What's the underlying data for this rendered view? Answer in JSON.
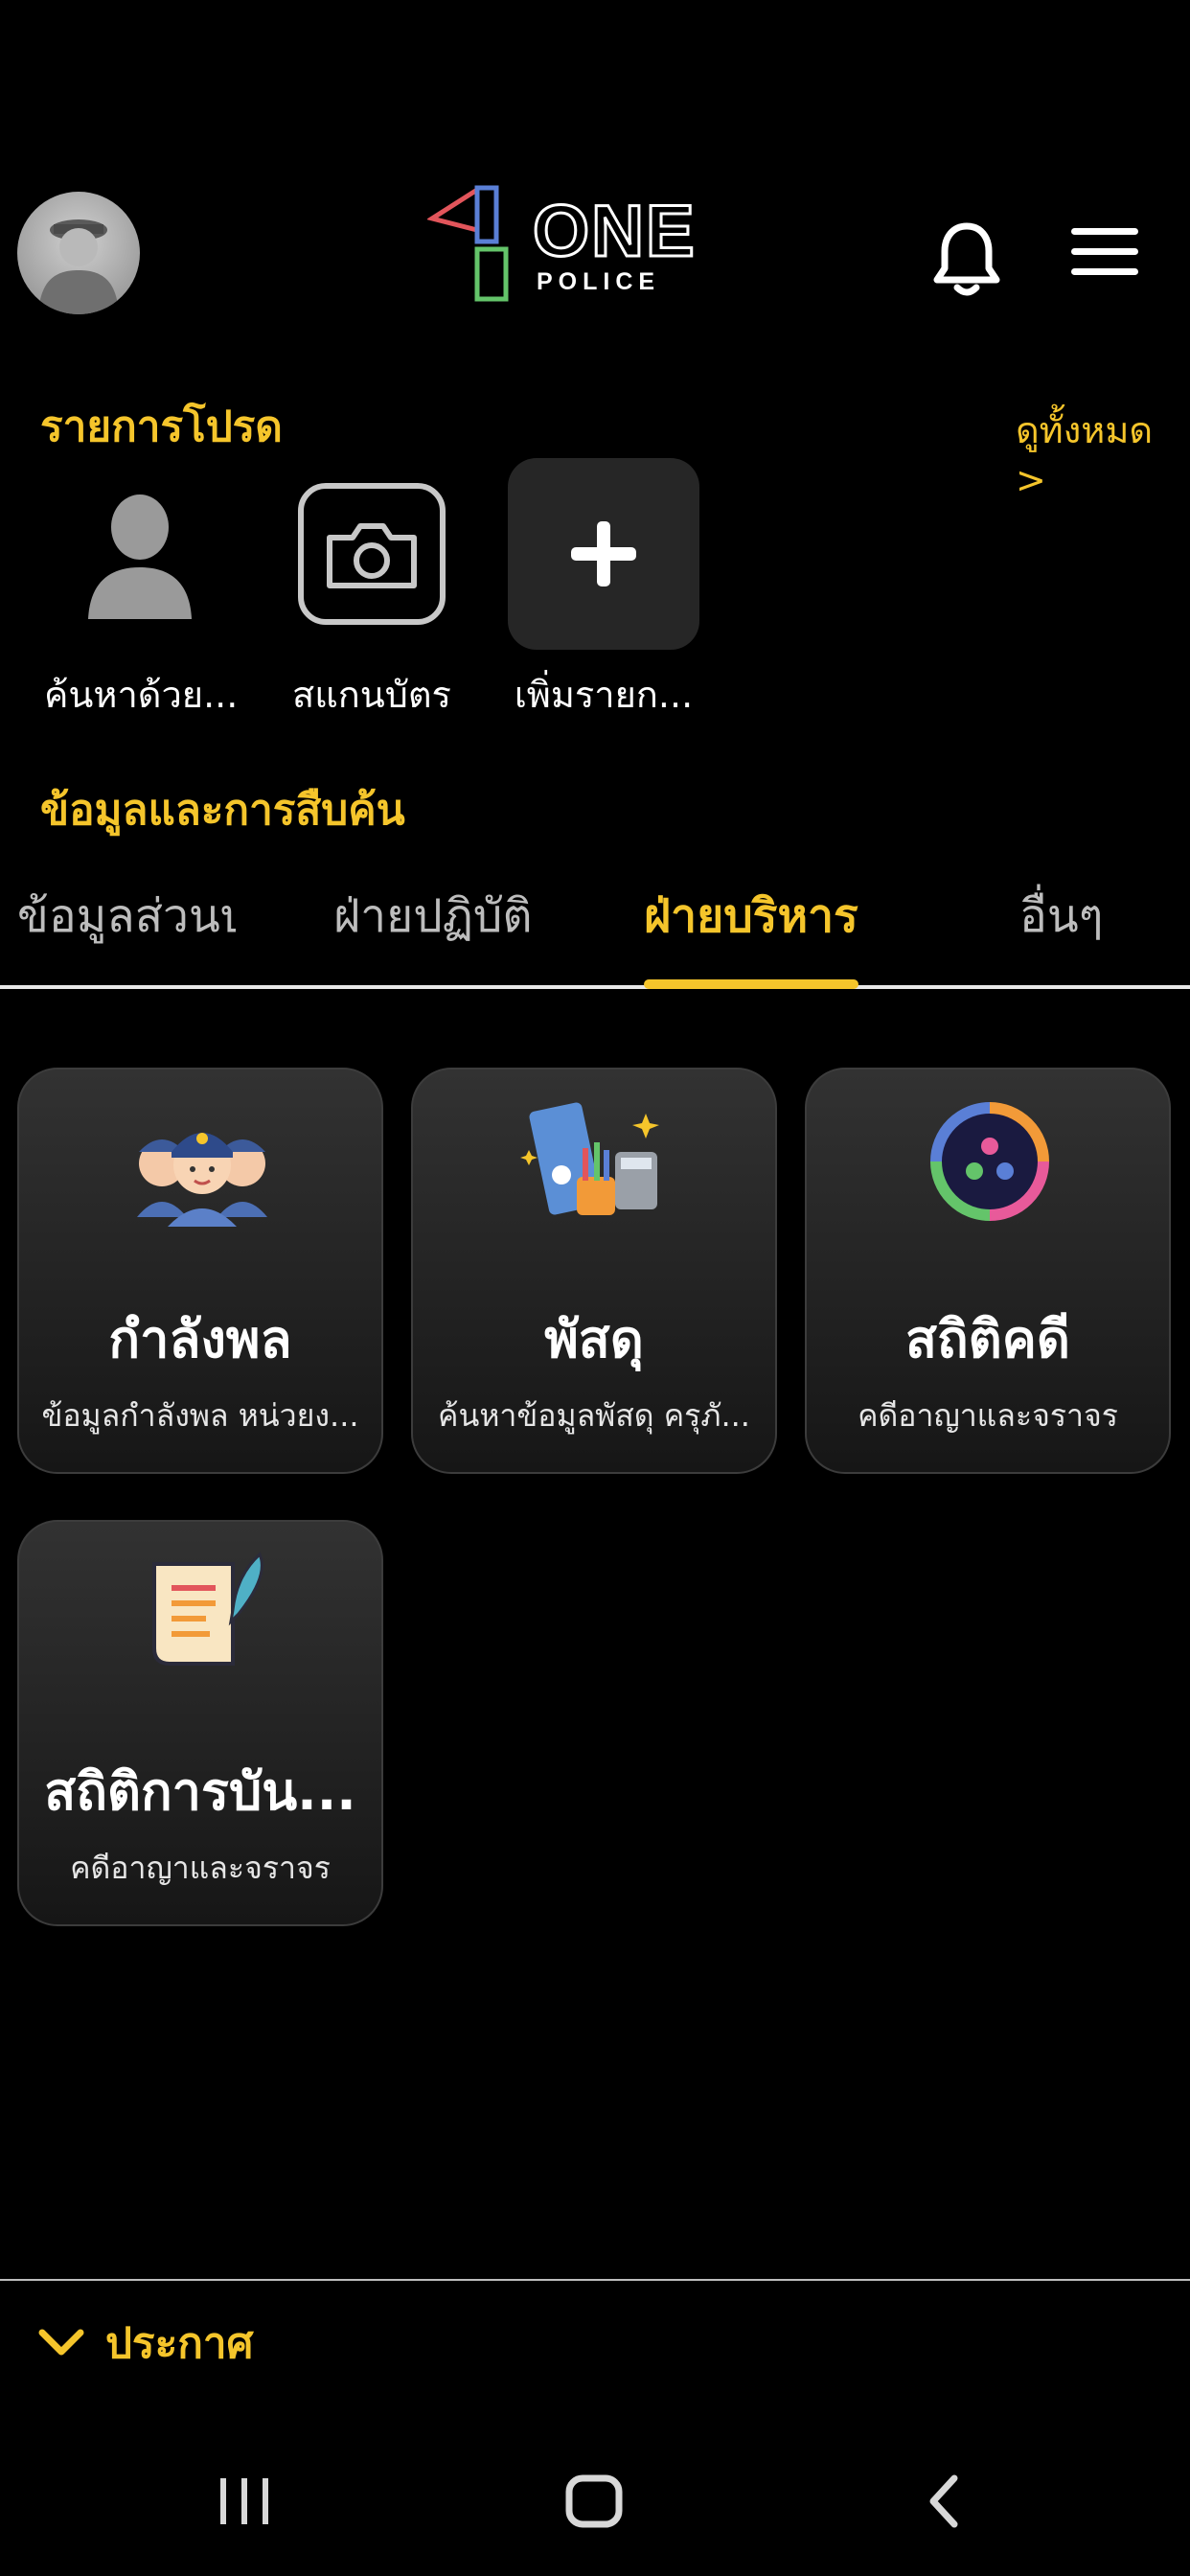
{
  "header": {
    "logo_main": "ONE",
    "logo_sub": "POLICE",
    "icons": [
      "officer-avatar",
      "bell-icon",
      "hamburger-menu-icon"
    ]
  },
  "favorites": {
    "title": "รายการโปรด",
    "see_all": "ดูทั้งหมด >",
    "items": [
      {
        "label": "ค้นหาด้วย...",
        "icon": "person-icon"
      },
      {
        "label": "สแกนบัตร",
        "icon": "camera-icon"
      },
      {
        "label": "เพิ่มรายก...",
        "icon": "plus-icon"
      }
    ]
  },
  "investigation": {
    "title": "ข้อมูลและการสืบค้น",
    "tabs": [
      {
        "label": "ข้อมูลส่วนบ",
        "active": false
      },
      {
        "label": "ฝ่ายปฏิบัติ",
        "active": false
      },
      {
        "label": "ฝ่ายบริหาร",
        "active": true
      },
      {
        "label": "อื่นๆ",
        "active": false
      }
    ]
  },
  "cards": [
    {
      "title": "กำลังพล",
      "subtitle": "ข้อมูลกำลังพล หน่วยง...",
      "icon": "police-officers-icon"
    },
    {
      "title": "พัสดุ",
      "subtitle": "ค้นหาข้อมูลพัสดุ ครุภั...",
      "icon": "office-supplies-icon"
    },
    {
      "title": "สถิติคดี",
      "subtitle": "คดีอาญาและจราจร",
      "icon": "statistics-ring-icon"
    },
    {
      "title": "สถิติการบัน...",
      "subtitle": "คดีอาญาและจราจร",
      "icon": "document-quill-icon"
    }
  ],
  "announcement": {
    "label": "ประกาศ"
  },
  "colors": {
    "accent": "#f5c52b",
    "background": "#000000",
    "card": "#262626"
  }
}
